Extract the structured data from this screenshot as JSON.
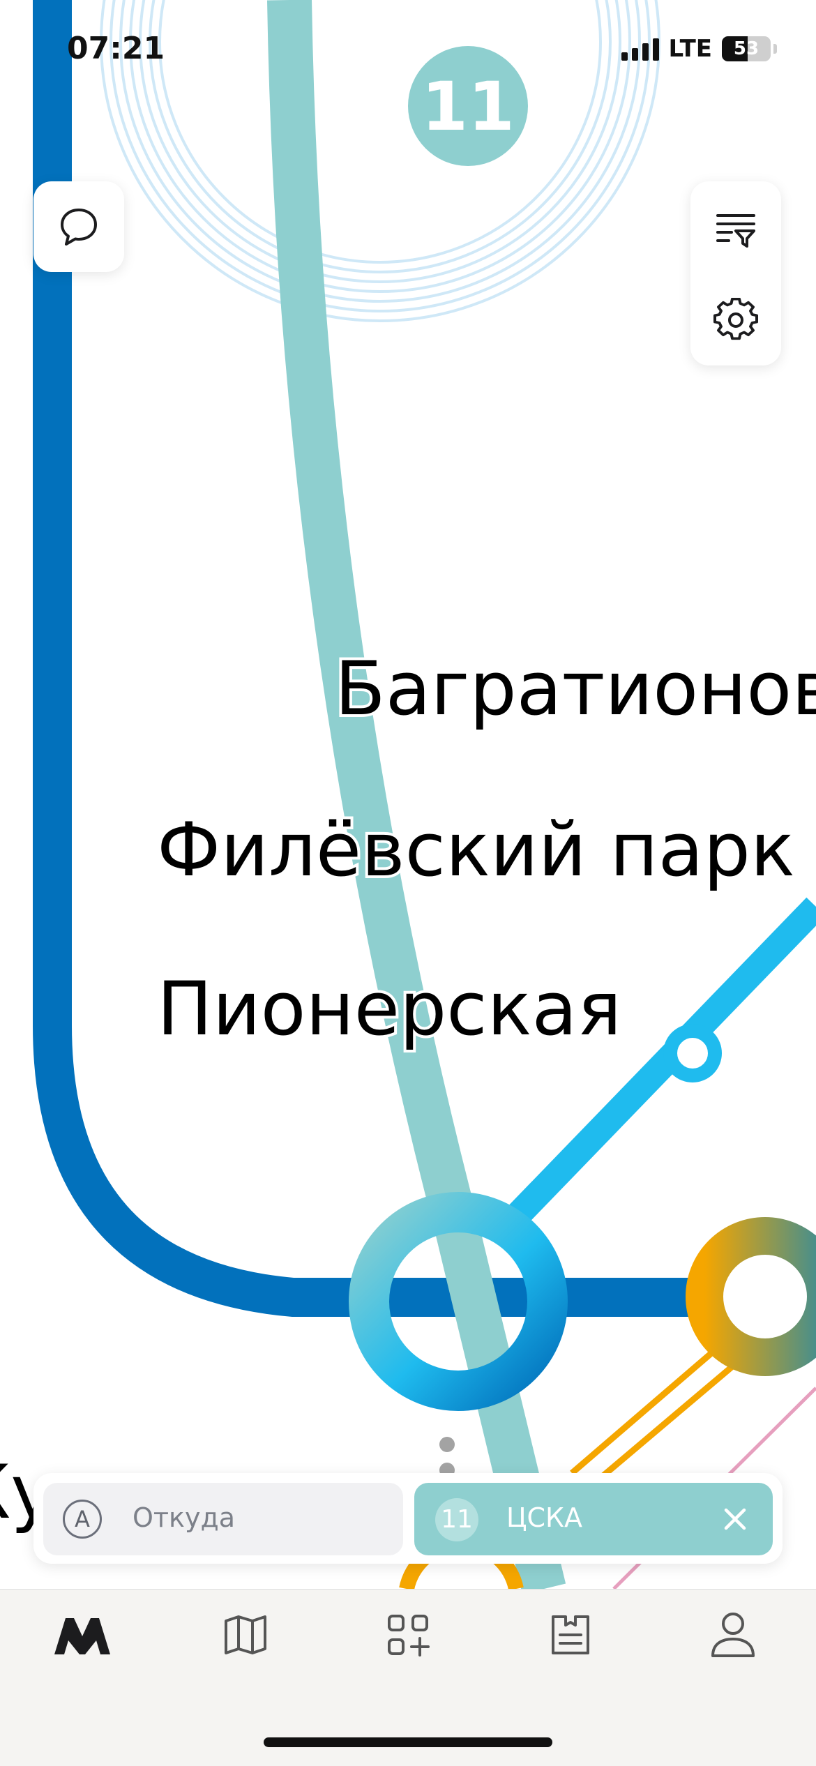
{
  "status_bar": {
    "time": "07:21",
    "network": "LTE",
    "battery_level": "53",
    "battery_fraction": 0.53
  },
  "map": {
    "line_badge_number": "11",
    "stations": {
      "bagrationovskaya": "Багратионовская",
      "filevsky_park": "Филёвский парк",
      "pionerskaya": "Пионерская",
      "kuntsevskaya": "Кунцевская"
    }
  },
  "route": {
    "from_point": "A",
    "from_placeholder": "Откуда",
    "to_line_number": "11",
    "to_station": "ЦСКА"
  },
  "tabs": [
    "metro-icon",
    "map-icon",
    "services-icon",
    "tickets-icon",
    "profile-icon"
  ],
  "colors": {
    "line_11": "#8ecfcf",
    "line_3": "#0271bc",
    "line_4": "#1fbbee",
    "line_8": "#f5a600",
    "line_pink": "#e69fbe",
    "accent_pale_blue": "#cfe8f7"
  }
}
